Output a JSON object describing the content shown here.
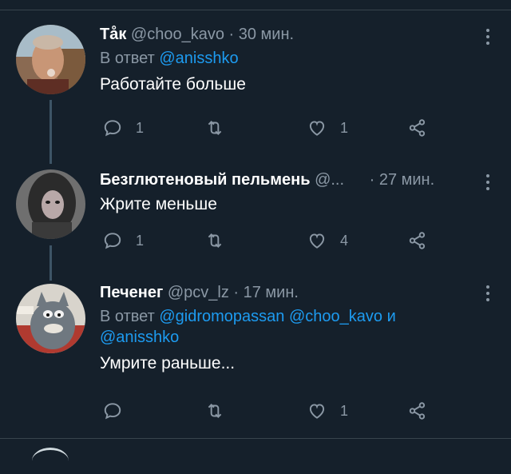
{
  "tweets": [
    {
      "name": "Тåк",
      "handle": "@choo_kavo",
      "time": "· 30 мин.",
      "reply_prefix": "В ответ",
      "mentions": [
        "@anisshko"
      ],
      "text": "Работайте больше",
      "replies": "1",
      "retweets": "",
      "likes": "1"
    },
    {
      "name": "Безглютеновый пельмень",
      "handle": "@...",
      "time": "· 27 мин.",
      "text": "Жрите меньше",
      "replies": "1",
      "retweets": "",
      "likes": "4"
    },
    {
      "name": "Печенег",
      "handle": "@pcv_lz",
      "time": "· 17 мин.",
      "reply_prefix": "В ответ",
      "mentions": [
        "@gidromopassan",
        "@choo_kavo",
        "@anisshko"
      ],
      "conjunction": "и",
      "text": "Умрите раньше...",
      "replies": "",
      "retweets": "",
      "likes": "1"
    }
  ],
  "icons": {
    "reply": "reply-icon",
    "retweet": "retweet-icon",
    "like": "heart-icon",
    "share": "share-icon",
    "more": "more-icon"
  },
  "colors": {
    "background": "#15202b",
    "text": "#ffffff",
    "secondary": "#8b98a5",
    "link": "#1d9bf0",
    "divider": "#38444d"
  }
}
